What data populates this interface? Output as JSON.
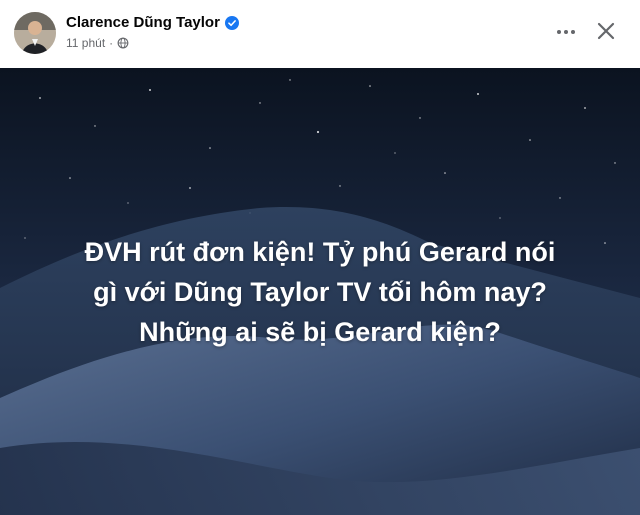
{
  "post": {
    "author": "Clarence Dũng Taylor",
    "time": "11 phút",
    "separator": "·",
    "text_lines": [
      "ĐVH rút đơn kiện! Tỷ phú Gerard nói",
      "gì với Dũng Taylor TV tối hôm nay?",
      "Những ai sẽ bị Gerard kiện?"
    ]
  },
  "icons": {
    "verified": "verified-badge-icon",
    "privacy": "globe-icon",
    "more": "more-horizontal-icon",
    "close": "close-icon"
  },
  "colors": {
    "verified_blue": "#1877f2",
    "meta_gray": "#65676b",
    "sky_top": "#0b1320",
    "sky_bottom": "#2b3d5e"
  }
}
